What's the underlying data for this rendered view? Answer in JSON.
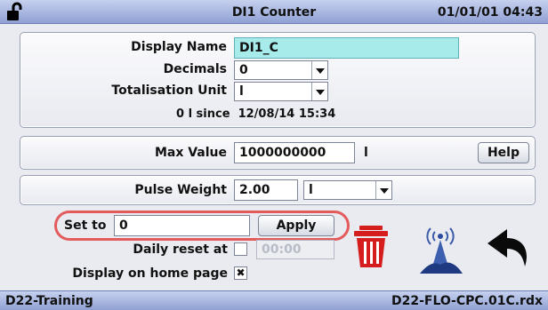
{
  "header": {
    "title": "DI1 Counter",
    "datetime": "01/01/01 04:43",
    "lock_icon": "unlocked-padlock-icon"
  },
  "settings": {
    "display_name_label": "Display Name",
    "display_name_value": "DI1_C",
    "decimals_label": "Decimals",
    "decimals_value": "0",
    "totalisation_unit_label": "Totalisation Unit",
    "totalisation_unit_value": "l",
    "total_text": "0 l since  12/08/14 15:34"
  },
  "max": {
    "label": "Max Value",
    "value": "1000000000",
    "unit": "l",
    "help_label": "Help"
  },
  "pulse": {
    "label": "Pulse Weight",
    "value": "2.00",
    "unit_value": "l"
  },
  "setto": {
    "label": "Set to",
    "value": "0",
    "apply_label": "Apply",
    "highlight_color": "#e35b5b"
  },
  "daily_reset": {
    "label": "Daily reset at",
    "time_placeholder": "00:00",
    "checked": false
  },
  "home": {
    "label": "Display on home page",
    "mark": "✖",
    "checked": true
  },
  "icons": {
    "delete": "trash-icon",
    "signal": "radio-tower-icon",
    "back": "back-arrow-icon"
  },
  "footer": {
    "left": "D22-Training",
    "right": "D22-FLO-CPC.01C.rdx"
  }
}
